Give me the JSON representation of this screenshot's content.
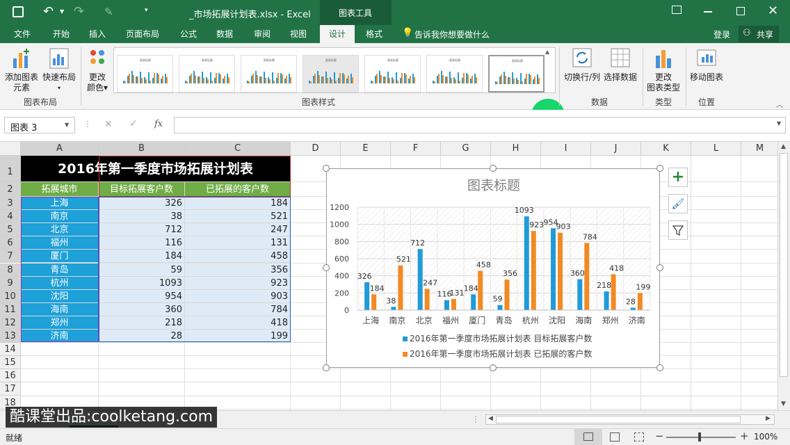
{
  "window": {
    "title": "_市场拓展计划表.xlsx - Excel",
    "context_tab": "图表工具"
  },
  "tabs": [
    "文件",
    "开始",
    "插入",
    "页面布局",
    "公式",
    "数据",
    "审阅",
    "视图",
    "设计",
    "格式"
  ],
  "tell_me": "告诉我你想要做什么",
  "login": "登录",
  "share": "共享",
  "ribbon": {
    "add_element": [
      "添加图表",
      "元素"
    ],
    "quick_layout": "快速布局",
    "change_color": [
      "更改",
      "颜色"
    ],
    "switch_row_col": "切换行/列",
    "select_data": "选择数据",
    "change_type": [
      "更改",
      "图表类型"
    ],
    "move_chart": "移动图表",
    "groups": {
      "layout": "图表布局",
      "styles": "图表样式",
      "data": "数据",
      "type": "类型",
      "location": "位置"
    },
    "thumb_title": "图表标题",
    "marker": "7"
  },
  "namebox": "图表 3",
  "fx": "fx",
  "columns": [
    "A",
    "B",
    "C",
    "D",
    "E",
    "F",
    "G",
    "H",
    "I",
    "J",
    "K",
    "L",
    "M"
  ],
  "rows": [
    "1",
    "2",
    "3",
    "4",
    "5",
    "6",
    "7",
    "8",
    "9",
    "10",
    "11",
    "12",
    "13",
    "14",
    "15",
    "16",
    "17",
    "18"
  ],
  "sheet": {
    "title": "2016年第一季度市场拓展计划表",
    "headers": [
      "拓展城市",
      "目标拓展客户数",
      "已拓展的客户数"
    ],
    "data": [
      [
        "上海",
        "326",
        "184"
      ],
      [
        "南京",
        "38",
        "521"
      ],
      [
        "北京",
        "712",
        "247"
      ],
      [
        "福州",
        "116",
        "131"
      ],
      [
        "厦门",
        "184",
        "458"
      ],
      [
        "青岛",
        "59",
        "356"
      ],
      [
        "杭州",
        "1093",
        "923"
      ],
      [
        "沈阳",
        "954",
        "903"
      ],
      [
        "海南",
        "360",
        "784"
      ],
      [
        "郑州",
        "218",
        "418"
      ],
      [
        "济南",
        "28",
        "199"
      ]
    ]
  },
  "chart_data": {
    "type": "bar",
    "title": "图表标题",
    "categories": [
      "上海",
      "南京",
      "北京",
      "福州",
      "厦门",
      "青岛",
      "杭州",
      "沈阳",
      "海南",
      "郑州",
      "济南"
    ],
    "series": [
      {
        "name": "2016年第一季度市场拓展计划表 目标拓展客户数",
        "values": [
          326,
          38,
          712,
          116,
          184,
          59,
          1093,
          954,
          360,
          218,
          28
        ],
        "color": "#1f9bd7"
      },
      {
        "name": "2016年第一季度市场拓展计划表 已拓展的客户数",
        "values": [
          184,
          521,
          247,
          131,
          458,
          356,
          923,
          903,
          784,
          418,
          199
        ],
        "color": "#f28a24"
      }
    ],
    "yticks": [
      "0",
      "200",
      "400",
      "600",
      "800",
      "1000",
      "1200"
    ],
    "ylim": [
      0,
      1200
    ],
    "legend": "bottom"
  },
  "watermark": "酷课堂出品:coolketang.com",
  "status": {
    "ready": "就绪",
    "zoom": "100%"
  },
  "colors": {
    "accent": "#217346",
    "header_bg": "#000000",
    "subheader_bg": "#70ad47",
    "city_bg": "#1ea0d8",
    "data_bg": "#deebf7"
  }
}
